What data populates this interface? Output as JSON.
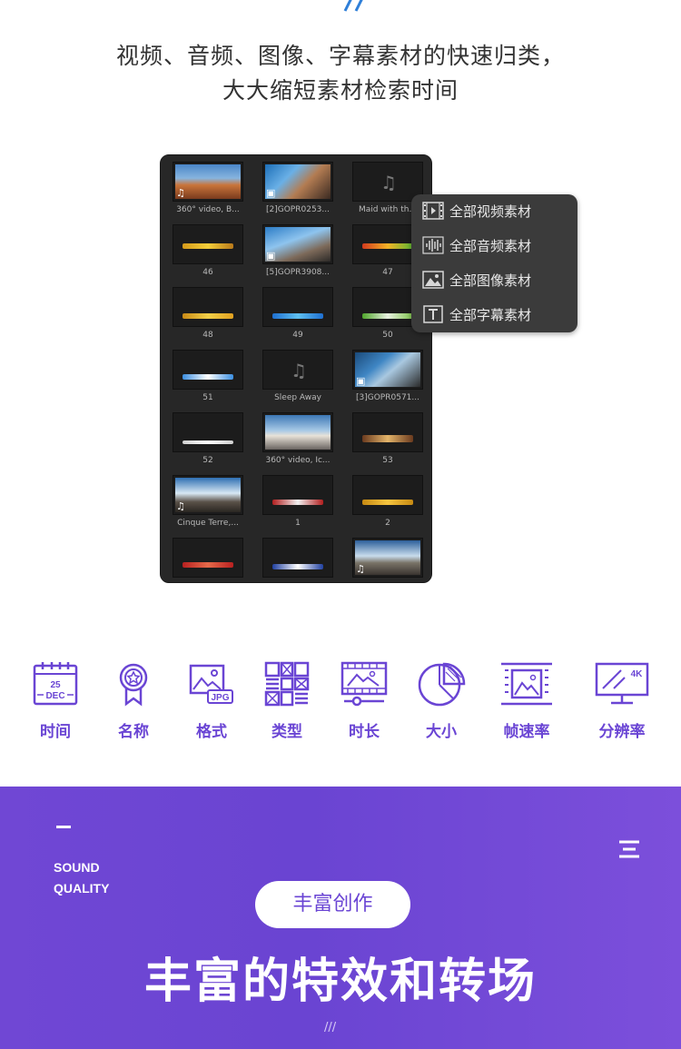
{
  "header": {
    "line1": "视频、音频、图像、字幕素材的快速归类，",
    "line2": "大大缩短素材检索时间"
  },
  "library": {
    "items": [
      {
        "caption": "360° video, B...",
        "kind": "video"
      },
      {
        "caption": "[2]GOPR0253...",
        "kind": "image"
      },
      {
        "caption": "Maid with th...",
        "kind": "audio"
      },
      {
        "caption": "46",
        "kind": "title"
      },
      {
        "caption": "[5]GOPR3908...",
        "kind": "image"
      },
      {
        "caption": "47",
        "kind": "title"
      },
      {
        "caption": "48",
        "kind": "title"
      },
      {
        "caption": "49",
        "kind": "title"
      },
      {
        "caption": "50",
        "kind": "title"
      },
      {
        "caption": "51",
        "kind": "title"
      },
      {
        "caption": "Sleep Away",
        "kind": "audio"
      },
      {
        "caption": "[3]GOPR0571...",
        "kind": "image"
      },
      {
        "caption": "52",
        "kind": "title"
      },
      {
        "caption": "360° video, Ic...",
        "kind": "video"
      },
      {
        "caption": "53",
        "kind": "title"
      },
      {
        "caption": "Cinque Terre,...",
        "kind": "video"
      },
      {
        "caption": "1",
        "kind": "title"
      },
      {
        "caption": "2",
        "kind": "title"
      },
      {
        "caption": "",
        "kind": "title"
      },
      {
        "caption": "",
        "kind": "title"
      },
      {
        "caption": "",
        "kind": "video"
      }
    ]
  },
  "filter_menu": {
    "items": [
      {
        "label": "全部视频素材",
        "icon": "film-icon"
      },
      {
        "label": "全部音频素材",
        "icon": "waveform-icon"
      },
      {
        "label": "全部图像素材",
        "icon": "image-icon"
      },
      {
        "label": "全部字幕素材",
        "icon": "text-icon"
      }
    ]
  },
  "calendar": {
    "day": "25",
    "month": "DEC"
  },
  "image_format_badge": "JPG",
  "resolution_badge": "4K",
  "sort_features": [
    {
      "label": "时间",
      "icon": "calendar-icon"
    },
    {
      "label": "名称",
      "icon": "badge-icon"
    },
    {
      "label": "格式",
      "icon": "image-format-icon"
    },
    {
      "label": "类型",
      "icon": "grid-type-icon"
    },
    {
      "label": "时长",
      "icon": "film-duration-icon"
    },
    {
      "label": "大小",
      "icon": "pie-size-icon"
    },
    {
      "label": "帧速率",
      "icon": "framerate-icon"
    },
    {
      "label": "分辨率",
      "icon": "monitor-resolution-icon"
    }
  ],
  "promo": {
    "sound_line1": "SOUND",
    "sound_line2": "QUALITY",
    "pill": "丰富创作",
    "title": "丰富的特效和转场",
    "slash": "///"
  },
  "colors": {
    "accent": "#6a45d4",
    "panel": "#272727",
    "menu": "#3b3b3b",
    "slash": "#2f7fd8"
  }
}
